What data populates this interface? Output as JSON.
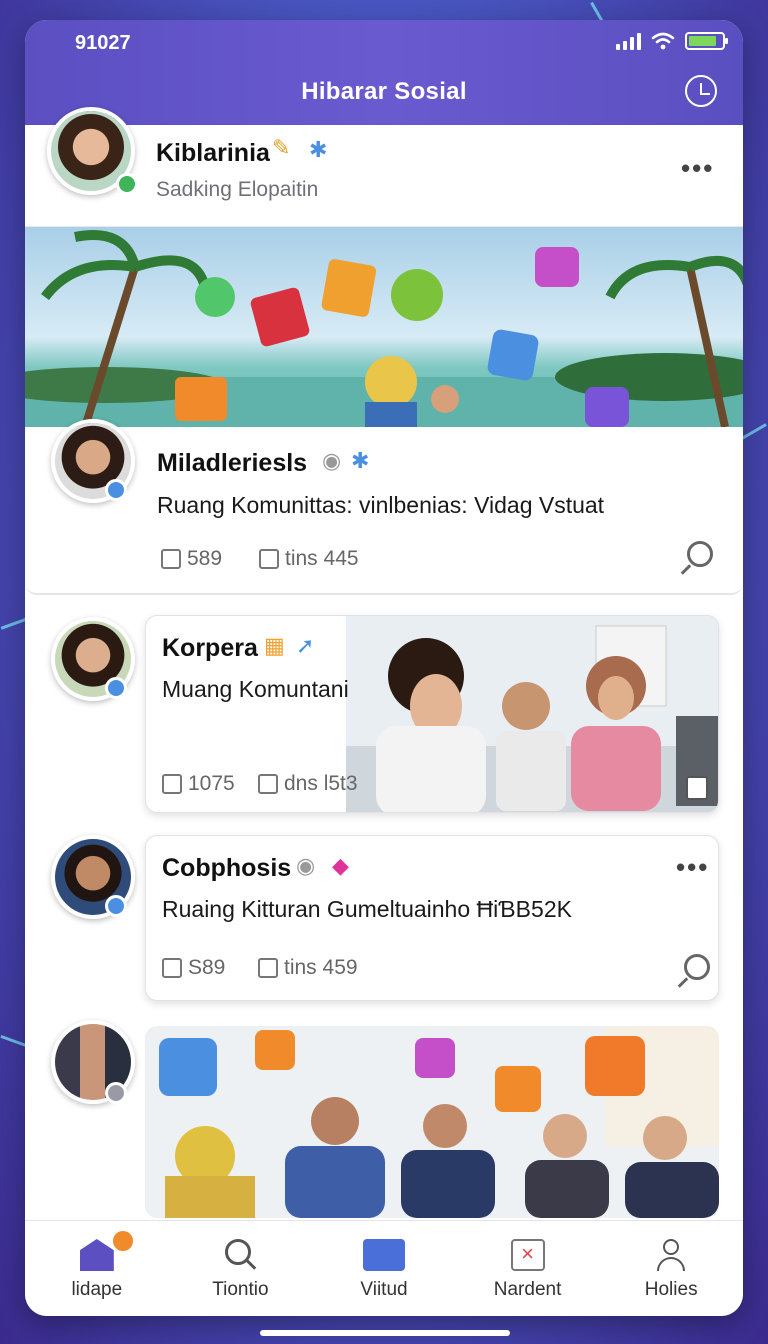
{
  "status": {
    "time": "91027"
  },
  "header": {
    "title": "Hibarar Sosial"
  },
  "profile": {
    "name": "Kiblarinia",
    "subtitle": "Sadking Elopaitin"
  },
  "posts": [
    {
      "name": "Miladleriesls",
      "text": "Ruang Komunittas: vinlbenias: Vidag Vstuat",
      "likes": "589",
      "comments": "tins  445"
    },
    {
      "name": "Korpera",
      "text": "Muang Komuntani",
      "likes": "1075",
      "comments": "dns l5t3"
    },
    {
      "name": "Cobphosis",
      "text": "Ruaing Kitturan Gumeltuainho ĦiƁB52K",
      "likes": "S89",
      "comments": "tins  459"
    }
  ],
  "nav": [
    {
      "label": "lidape",
      "badge": ""
    },
    {
      "label": "Tiontio"
    },
    {
      "label": "Viitud"
    },
    {
      "label": "Nardent"
    },
    {
      "label": "Holies"
    }
  ],
  "colors": {
    "header": "#5b4fc2",
    "accent": "#4a8fe0",
    "badge": "#f08a2a"
  }
}
